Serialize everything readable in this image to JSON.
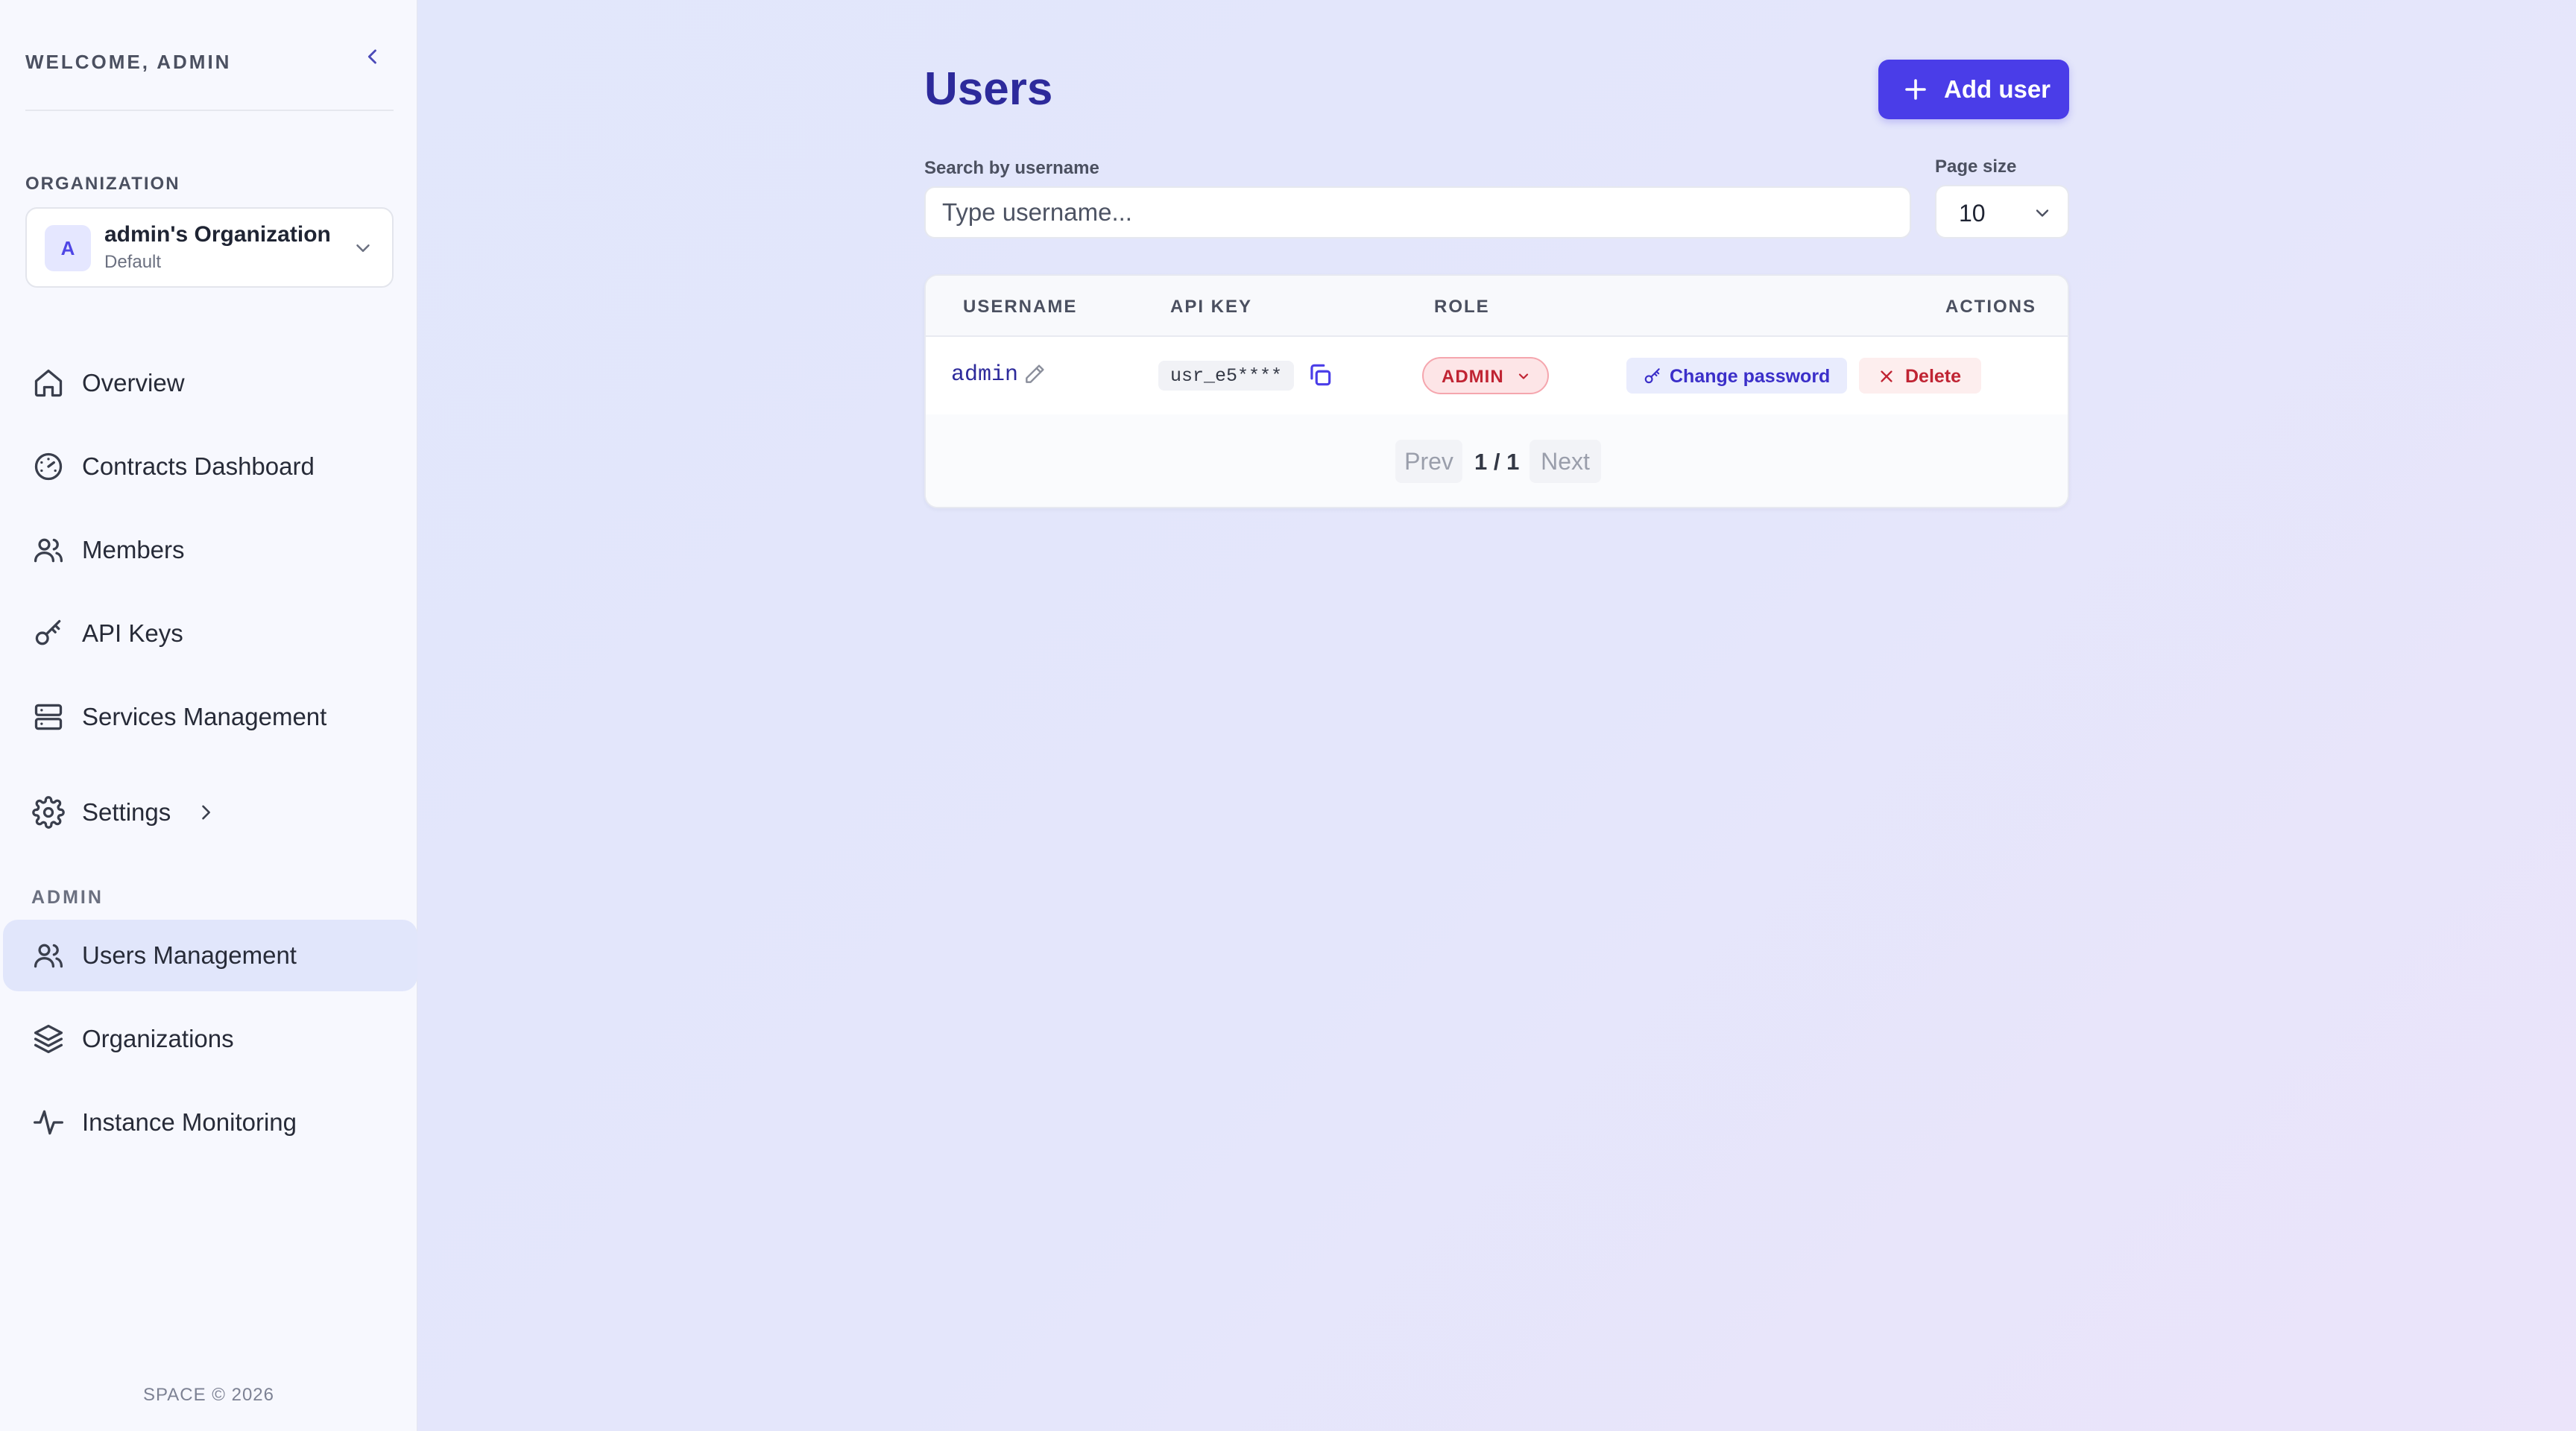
{
  "sidebar": {
    "welcome": "WELCOME, ADMIN",
    "organization_label": "ORGANIZATION",
    "organization": {
      "avatar": "A",
      "name": "admin's Organization",
      "subtitle": "Default"
    },
    "nav": [
      {
        "label": "Overview",
        "icon": "home-icon"
      },
      {
        "label": "Contracts Dashboard",
        "icon": "gauge-icon"
      },
      {
        "label": "Members",
        "icon": "users-icon"
      },
      {
        "label": "API Keys",
        "icon": "key-icon"
      },
      {
        "label": "Services Management",
        "icon": "server-icon"
      },
      {
        "label": "Settings",
        "icon": "gear-icon"
      }
    ],
    "admin_label": "ADMIN",
    "admin_nav": [
      {
        "label": "Users Management",
        "icon": "users-icon",
        "active": true
      },
      {
        "label": "Organizations",
        "icon": "layers-icon"
      },
      {
        "label": "Instance Monitoring",
        "icon": "activity-icon"
      }
    ],
    "footer": "SPACE © 2026"
  },
  "main": {
    "title": "Users",
    "add_button": "Add user",
    "search": {
      "label": "Search by username",
      "placeholder": "Type username...",
      "value": ""
    },
    "page_size": {
      "label": "Page size",
      "value": "10"
    },
    "table": {
      "columns": [
        "USERNAME",
        "API KEY",
        "ROLE",
        "ACTIONS"
      ],
      "rows": [
        {
          "username": "admin",
          "api_key": "usr_e5****",
          "role": "ADMIN",
          "change_password": "Change password",
          "delete": "Delete"
        }
      ]
    },
    "pagination": {
      "prev": "Prev",
      "current": "1 / 1",
      "next": "Next"
    }
  },
  "colors": {
    "accent": "#4a3de8",
    "title": "#2d2a9b",
    "danger": "#c02433",
    "active_nav": "#e1e6fb"
  }
}
